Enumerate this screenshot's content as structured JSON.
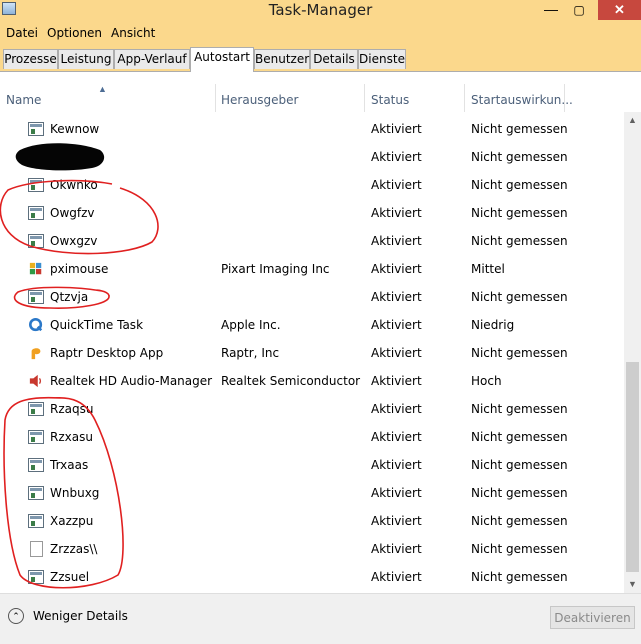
{
  "window": {
    "title": "Task-Manager",
    "minimize": "—",
    "maximize": "▢",
    "close": "✕"
  },
  "menu": [
    "Datei",
    "Optionen",
    "Ansicht"
  ],
  "tabs": [
    "Prozesse",
    "Leistung",
    "App-Verlauf",
    "Autostart",
    "Benutzer",
    "Details",
    "Dienste"
  ],
  "active_tab": "Autostart",
  "columns": {
    "name": "Name",
    "publisher": "Herausgeber",
    "status": "Status",
    "impact": "Startauswirkun..."
  },
  "rows": [
    {
      "name": "Kewnow",
      "publisher": "",
      "status": "Aktiviert",
      "impact": "Nicht gemessen",
      "icon": "generic-app-icon"
    },
    {
      "name": "",
      "publisher": "",
      "status": "Aktiviert",
      "impact": "Nicht gemessen",
      "icon": "redacted"
    },
    {
      "name": "Okwnko",
      "publisher": "",
      "status": "Aktiviert",
      "impact": "Nicht gemessen",
      "icon": "generic-app-icon"
    },
    {
      "name": "Owgfzv",
      "publisher": "",
      "status": "Aktiviert",
      "impact": "Nicht gemessen",
      "icon": "generic-app-icon"
    },
    {
      "name": "Owxgzv",
      "publisher": "",
      "status": "Aktiviert",
      "impact": "Nicht gemessen",
      "icon": "generic-app-icon"
    },
    {
      "name": "pximouse",
      "publisher": "Pixart Imaging Inc",
      "status": "Aktiviert",
      "impact": "Mittel",
      "icon": "pixart-icon"
    },
    {
      "name": "Qtzvja",
      "publisher": "",
      "status": "Aktiviert",
      "impact": "Nicht gemessen",
      "icon": "generic-app-icon"
    },
    {
      "name": "QuickTime Task",
      "publisher": "Apple Inc.",
      "status": "Aktiviert",
      "impact": "Niedrig",
      "icon": "quicktime-icon"
    },
    {
      "name": "Raptr Desktop App",
      "publisher": "Raptr, Inc",
      "status": "Aktiviert",
      "impact": "Nicht gemessen",
      "icon": "raptr-icon"
    },
    {
      "name": "Realtek HD Audio-Manager",
      "publisher": "Realtek Semiconductor",
      "status": "Aktiviert",
      "impact": "Hoch",
      "icon": "speaker-icon"
    },
    {
      "name": "Rzaqsu",
      "publisher": "",
      "status": "Aktiviert",
      "impact": "Nicht gemessen",
      "icon": "generic-app-icon"
    },
    {
      "name": "Rzxasu",
      "publisher": "",
      "status": "Aktiviert",
      "impact": "Nicht gemessen",
      "icon": "generic-app-icon"
    },
    {
      "name": "Trxaas",
      "publisher": "",
      "status": "Aktiviert",
      "impact": "Nicht gemessen",
      "icon": "generic-app-icon"
    },
    {
      "name": "Wnbuxg",
      "publisher": "",
      "status": "Aktiviert",
      "impact": "Nicht gemessen",
      "icon": "generic-app-icon"
    },
    {
      "name": "Xazzpu",
      "publisher": "",
      "status": "Aktiviert",
      "impact": "Nicht gemessen",
      "icon": "generic-app-icon"
    },
    {
      "name": "Zrzzas\\\\",
      "publisher": "",
      "status": "Aktiviert",
      "impact": "Nicht gemessen",
      "icon": "document-icon"
    },
    {
      "name": "Zzsuel",
      "publisher": "",
      "status": "Aktiviert",
      "impact": "Nicht gemessen",
      "icon": "generic-app-icon"
    }
  ],
  "footer": {
    "fewer_details": "Weniger Details",
    "deactivate": "Deaktivieren"
  },
  "colors": {
    "titlebar": "#fbd88c",
    "annotation": "#e02020",
    "header_text": "#4c607a"
  }
}
